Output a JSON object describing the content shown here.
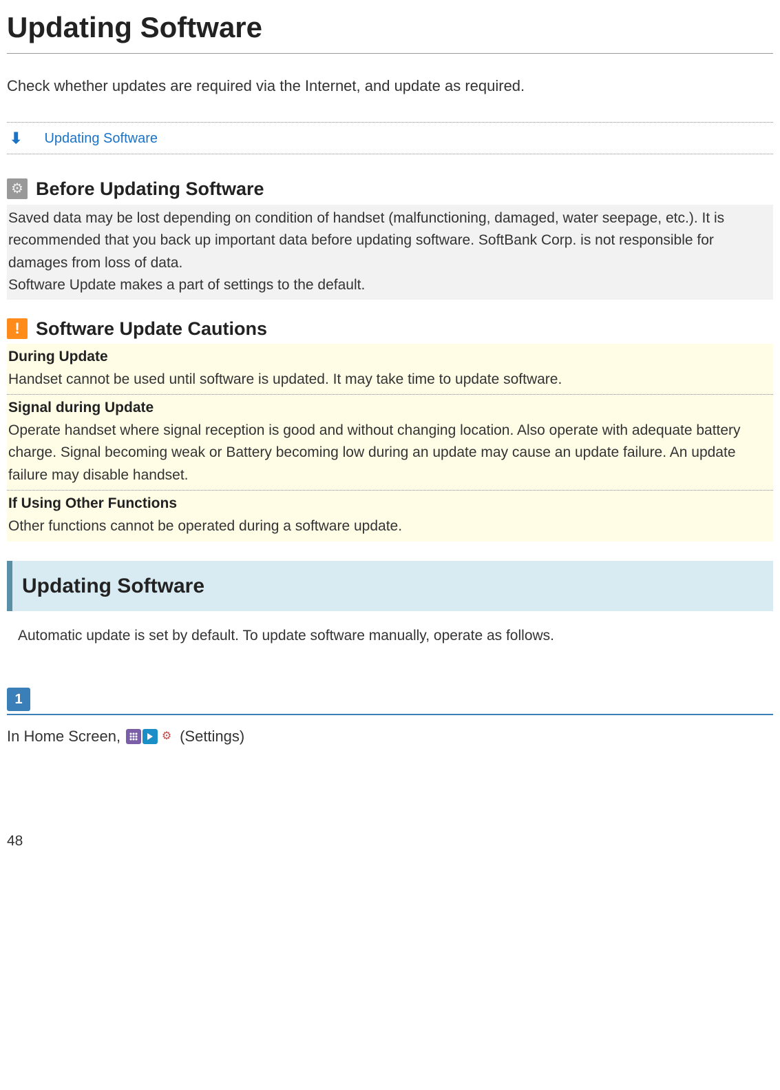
{
  "page": {
    "title": "Updating Software",
    "intro": "Check whether updates are required via the Internet, and update as required.",
    "number": "48"
  },
  "toc": {
    "link": "Updating Software"
  },
  "before": {
    "title": "Before Updating Software",
    "text1": "Saved data may be lost depending on condition of handset (malfunctioning, damaged, water seepage, etc.). It is recommended that you back up important data before updating software. SoftBank Corp. is not responsible for damages from loss of data.",
    "text2": "Software Update makes a part of settings to the default."
  },
  "cautions": {
    "title": "Software Update Cautions",
    "items": [
      {
        "title": "During Update",
        "text": "Handset cannot be used until software is updated. It may take time to update software."
      },
      {
        "title": "Signal during Update",
        "text": "Operate handset where signal reception is good and without changing location. Also operate with adequate battery charge. Signal becoming weak or Battery becoming low during an update may cause an update failure. An update failure may disable handset."
      },
      {
        "title": "If Using Other Functions",
        "text": "Other functions cannot be operated during a software update."
      }
    ]
  },
  "section": {
    "header": "Updating Software",
    "body": "Automatic update is set by default. To update software manually, operate as follows."
  },
  "step1": {
    "num": "1",
    "prefix": "In Home Screen,",
    "suffix": "(Settings)"
  }
}
